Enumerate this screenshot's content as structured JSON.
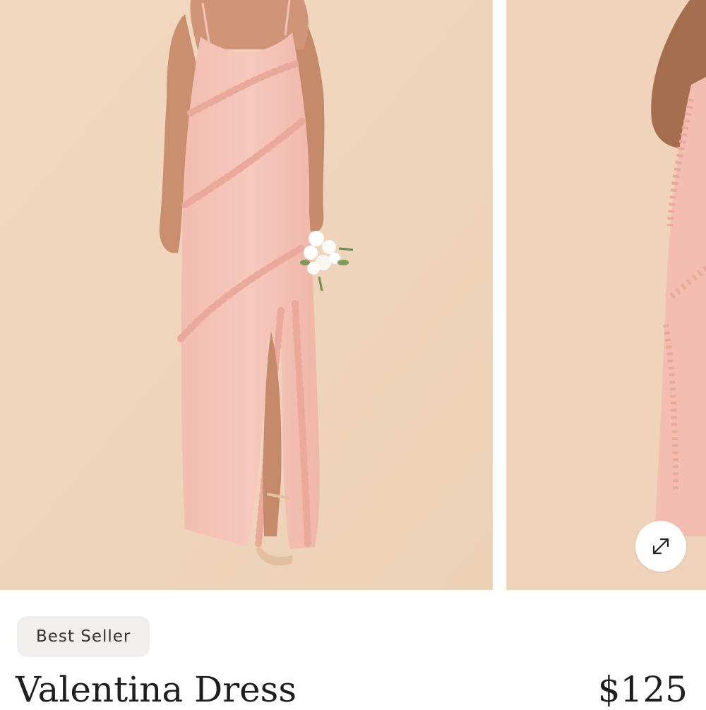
{
  "product": {
    "badge": "Best Seller",
    "name": "Valentina Dress",
    "price": "$125"
  },
  "gallery": {
    "expand_icon": "expand-arrows-icon"
  },
  "colors": {
    "backdrop": "#efd5bc",
    "dress": "#f4bfb3",
    "badge_bg": "#f0efed",
    "text": "#1e1e1e"
  }
}
